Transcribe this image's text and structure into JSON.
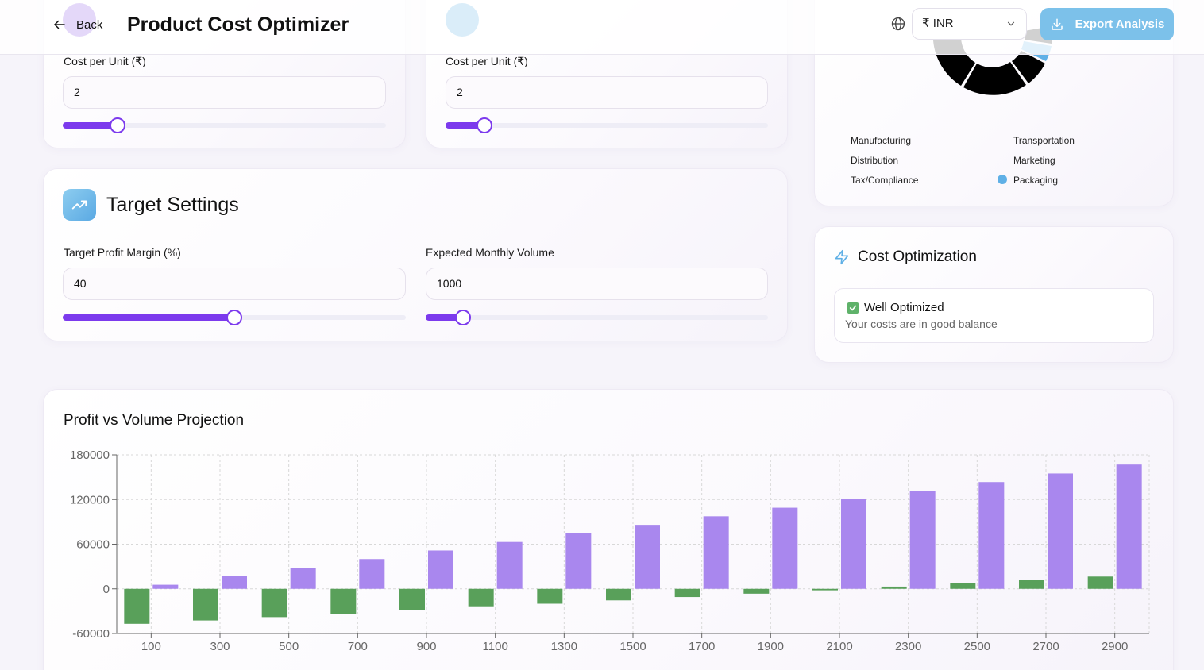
{
  "header": {
    "back_label": "Back",
    "title": "Product Cost Optimizer",
    "currency_value": "₹ INR",
    "export_label": "Export Analysis"
  },
  "cost_cards": [
    {
      "label": "Cost per Unit (₹)",
      "value": "2",
      "slider_fraction": 0.17
    },
    {
      "label": "Cost per Unit (₹)",
      "value": "2",
      "slider_fraction": 0.12
    }
  ],
  "target_settings": {
    "title": "Target Settings",
    "margin_label": "Target Profit Margin (%)",
    "margin_value": "40",
    "margin_fraction": 0.5,
    "volume_label": "Expected Monthly Volume",
    "volume_value": "1000",
    "volume_fraction": 0.11
  },
  "breakdown_legend": [
    {
      "label": "Manufacturing",
      "dot": false
    },
    {
      "label": "Transportation",
      "dot": false
    },
    {
      "label": "Distribution",
      "dot": false
    },
    {
      "label": "Marketing",
      "dot": false
    },
    {
      "label": "Tax/Compliance",
      "dot": false
    },
    {
      "label": "Packaging",
      "dot": true
    }
  ],
  "cost_optimization": {
    "title": "Cost Optimization",
    "status_title": "Well Optimized",
    "status_text": "Your costs are in good balance"
  },
  "colors": {
    "accent": "#7c3aed",
    "export_bg": "#7cc1ea",
    "profit_bar": "#59a05a",
    "revenue_bar": "#a987ee",
    "donut": "#000000",
    "donut_highlight": "#5fb0e6"
  },
  "chart_data": {
    "type": "bar",
    "title": "Profit vs Volume Projection",
    "x": [
      100,
      300,
      500,
      700,
      900,
      1100,
      1300,
      1500,
      1700,
      1900,
      2100,
      2300,
      2500,
      2700,
      2900
    ],
    "x_ticks": [
      "100",
      "300",
      "500",
      "700",
      "900",
      "1100",
      "1300",
      "1500",
      "1700",
      "1900",
      "2100",
      "2300",
      "2500",
      "2700",
      "2900"
    ],
    "ylim": [
      -60000,
      180000
    ],
    "y_ticks": [
      "180000",
      "120000",
      "60000",
      "0",
      "-60000"
    ],
    "y_tick_values": [
      180000,
      120000,
      60000,
      0,
      -60000
    ],
    "grid": true,
    "series": [
      {
        "values": [
          -47000,
          -42500,
          -38000,
          -33500,
          -29000,
          -24500,
          -20000,
          -15500,
          -11000,
          -6500,
          -2000,
          3000,
          7500,
          12000,
          16500
        ]
      },
      {
        "values": [
          5500,
          17000,
          28500,
          40000,
          51500,
          63000,
          74500,
          86000,
          97500,
          109000,
          120500,
          132000,
          143500,
          155000,
          167000
        ]
      }
    ]
  }
}
